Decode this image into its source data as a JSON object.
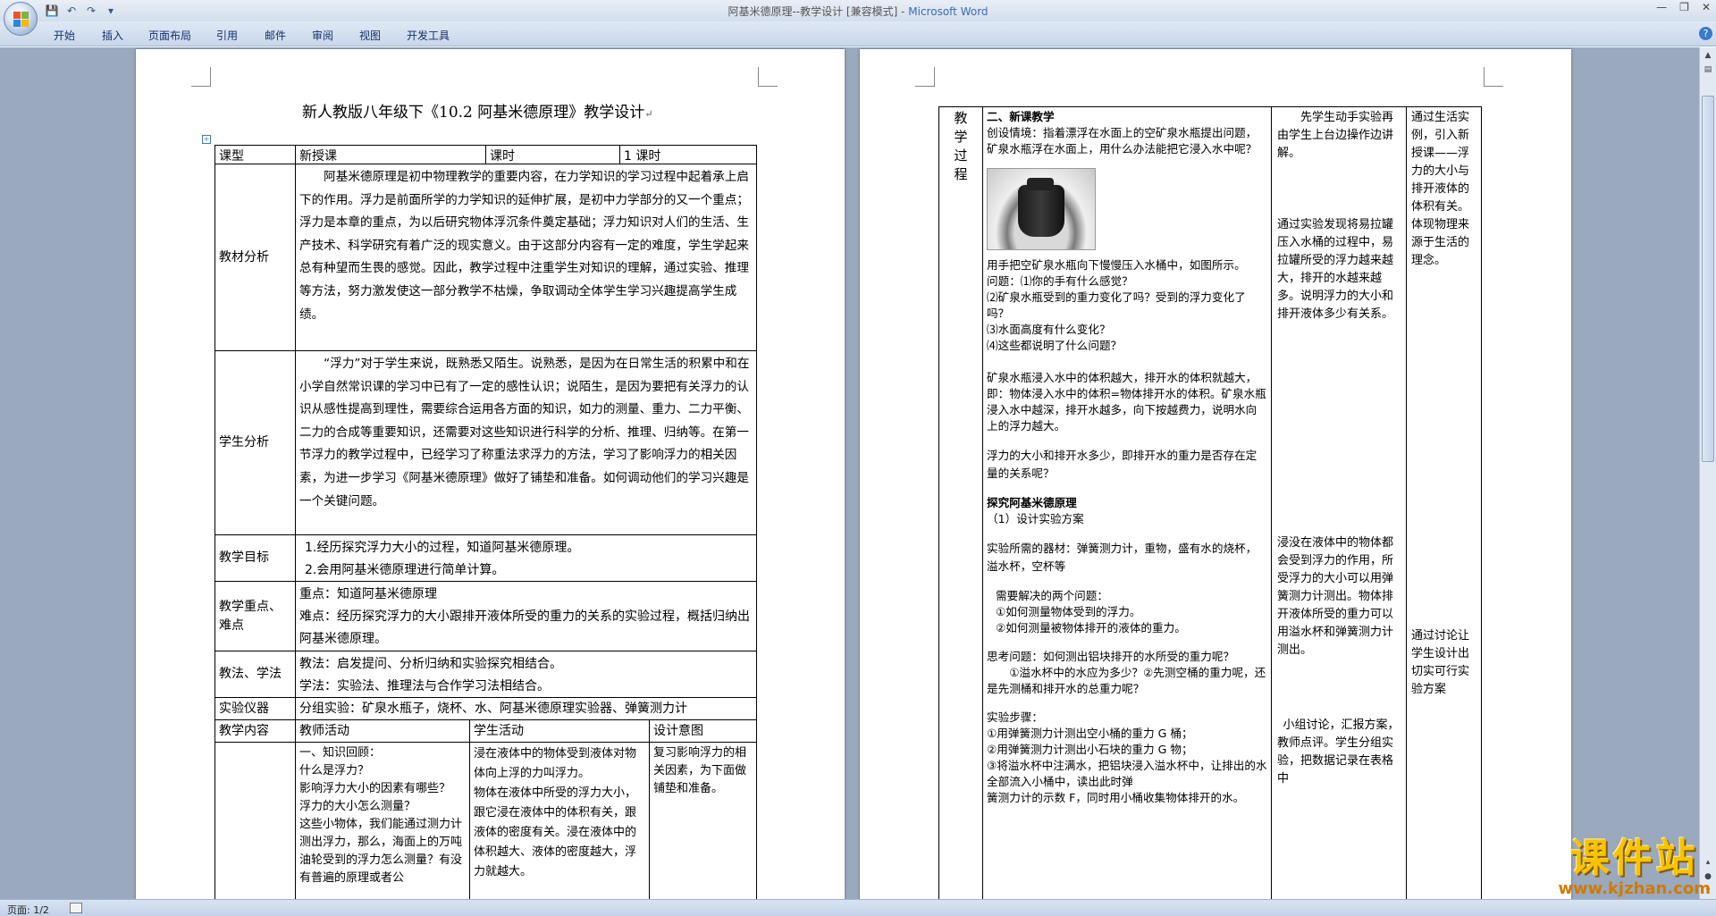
{
  "window": {
    "title": "阿基米德原理--教学设计 [兼容模式] - ",
    "app": "Microsoft Word"
  },
  "ribbon": {
    "tabs": [
      "开始",
      "插入",
      "页面布局",
      "引用",
      "邮件",
      "审阅",
      "视图",
      "开发工具"
    ]
  },
  "qat": [
    "💾",
    "↶",
    "↷",
    "▾"
  ],
  "status": {
    "page": "页面: 1/2"
  },
  "watermark": {
    "text": "课件站",
    "url": "www.kjzhan.com"
  },
  "page1": {
    "title": "新人教版八年级下《10.2 阿基米德原理》教学设计",
    "r1": {
      "l1": "课型",
      "v1": "新授课",
      "l2": "课时",
      "v2": "1 课时"
    },
    "r2": {
      "label": "教材分析",
      "text": "　　阿基米德原理是初中物理教学的重要内容，在力学知识的学习过程中起着承上启下的作用。浮力是前面所学的力学知识的延伸扩展，是初中力学部分的又一个重点；浮力是本章的重点，为以后研究物体浮沉条件奠定基础；浮力知识对人们的生活、生产技术、科学研究有着广泛的现实意义。由于这部分内容有一定的难度，学生学起来总有种望而生畏的感觉。因此，教学过程中注重学生对知识的理解，通过实验、推理等方法，努力激发使这一部分教学不枯燥，争取调动全体学生学习兴趣提高学生成绩。"
    },
    "r3": {
      "label": "学生分析",
      "text": "　　“浮力”对于学生来说，既熟悉又陌生。说熟悉，是因为在日常生活的积累中和在小学自然常识课的学习中已有了一定的感性认识；说陌生，是因为要把有关浮力的认识从感性提高到理性，需要综合运用各方面的知识，如力的测量、重力、二力平衡、二力的合成等重要知识，还需要对这些知识进行科学的分析、推理、归纳等。在第一节浮力的教学过程中，已经学习了称重法求浮力的方法，学习了影响浮力的相关因素，为进一步学习《阿基米德原理》做好了铺垫和准备。如何调动他们的学习兴趣是一个关键问题。"
    },
    "r4": {
      "label": "教学目标",
      "l1": "1.经历探究浮力大小的过程，知道阿基米德原理。",
      "l2": "2.会用阿基米德原理进行简单计算。"
    },
    "r5": {
      "label": "教学重点、难点",
      "l1": "重点：知道阿基米德原理",
      "l2": "难点：经历探究浮力的大小跟排开液体所受的重力的关系的实验过程，概括归纳出阿基米德原理。"
    },
    "r6": {
      "label": "教法、学法",
      "l1": "教法：启发提问、分析归纳和实验探究相结合。",
      "l2": "学法：实验法、推理法与合作学习法相结合。"
    },
    "r7": {
      "label": "实验仪器",
      "text": "分组实验：矿泉水瓶子，烧杯、水、阿基米德原理实验器、弹簧测力计"
    },
    "r8": {
      "c1": "教学内容",
      "c2": "教师活动",
      "c3": "学生活动",
      "c4": "设计意图"
    },
    "r9": {
      "teacher": "一、知识回顾：\n什么是浮力？\n影响浮力大小的因素有哪些？\n浮力的大小怎么测量？\n这些小物体，我们能通过测力计测出浮力，那么，海面上的万吨油轮受到的浮力怎么测量？有没有普遍的原理或者公",
      "student": "浸在液体中的物体受到液体对物体向上浮的力叫浮力。\n物体在液体中所受的浮力大小，跟它浸在液体中的体积有关，跟液体的密度有关。浸在液体中的体积越大、液体的密度越大，浮力就越大。",
      "intent": "复习影响浮力的相关因素，为下面做铺垫和准备。"
    }
  },
  "page2": {
    "col1": "教学过程",
    "teacher": {
      "h1": "二、新课教学",
      "p1": "创设情境：指着漂浮在水面上的空矿泉水瓶提出问题，矿泉水瓶浮在水面上，用什么办法能把它浸入水中呢？",
      "p2": "用手把空矿泉水瓶向下慢慢压入水桶中，如图所示。",
      "q1": "问题：⑴你的手有什么感觉？",
      "q2": "⑵矿泉水瓶受到的重力变化了吗？受到的浮力变化了吗？",
      "q3": "⑶水面高度有什么变化？",
      "q4": "⑷这些都说明了什么问题？",
      "p3": "矿泉水瓶浸入水中的体积越大，排开水的体积就越大，即：物体浸入水中的体积=物体排开水的体积。矿泉水瓶浸入水中越深，排开水越多，向下按越费力，说明水向上的浮力越大。",
      "p4": "浮力的大小和排开水多少，即排开水的重力是否存在定量的关系呢？",
      "h2": "探究阿基米德原理",
      "p5": "（1）设计实验方案",
      "p6": "实验所需的器材：弹簧测力计，重物，盛有水的烧杯，溢水杯，空杯等",
      "p7": "需要解决的两个问题：",
      "p8": "①如何测量物体受到的浮力。",
      "p9": "②如何测量被物体排开的液体的重力。",
      "p10": "思考问题：如何测出铝块排开的水所受的重力呢？",
      "p11": "①溢水杯中的水应为多少？②先测空桶的重力呢，还是先测桶和排开水的总重力呢？",
      "p12": "实验步骤：",
      "p13": "①用弹簧测力计测出空小桶的重力 G 桶；",
      "p14": "②用弹簧测力计测出小石块的重力 G 物；",
      "p15": "③将溢水杯中注满水，把铝块浸入溢水杯中，让排出的水全部流入小桶中，读出此时弹",
      "p16": "簧测力计的示数 F，同时用小桶收集物体排开的水。"
    },
    "student": {
      "s1": "先学生动手实验再由学生上台边操作边讲解。",
      "s2": "通过实验发现将易拉罐压入水桶的过程中，易拉罐所受的浮力越来越大，排开的水越来越多。说明浮力的大小和排开液体多少有关系。",
      "s3": "浸没在液体中的物体都会受到浮力的作用，所受浮力的大小可以用弹簧测力计测出。物体排开液体所受的重力可以用溢水杯和弹簧测力计测出。",
      "s4": "小组讨论，汇报方案，教师点评。学生分组实验，把数据记录在表格中"
    },
    "intent": {
      "i1": "通过生活实例，引入新授课——浮力的大小与排开液体的体积有关。体现物理来源于生活的理念。",
      "i2": "通过讨论让学生设计出切实可行实验方案"
    }
  }
}
